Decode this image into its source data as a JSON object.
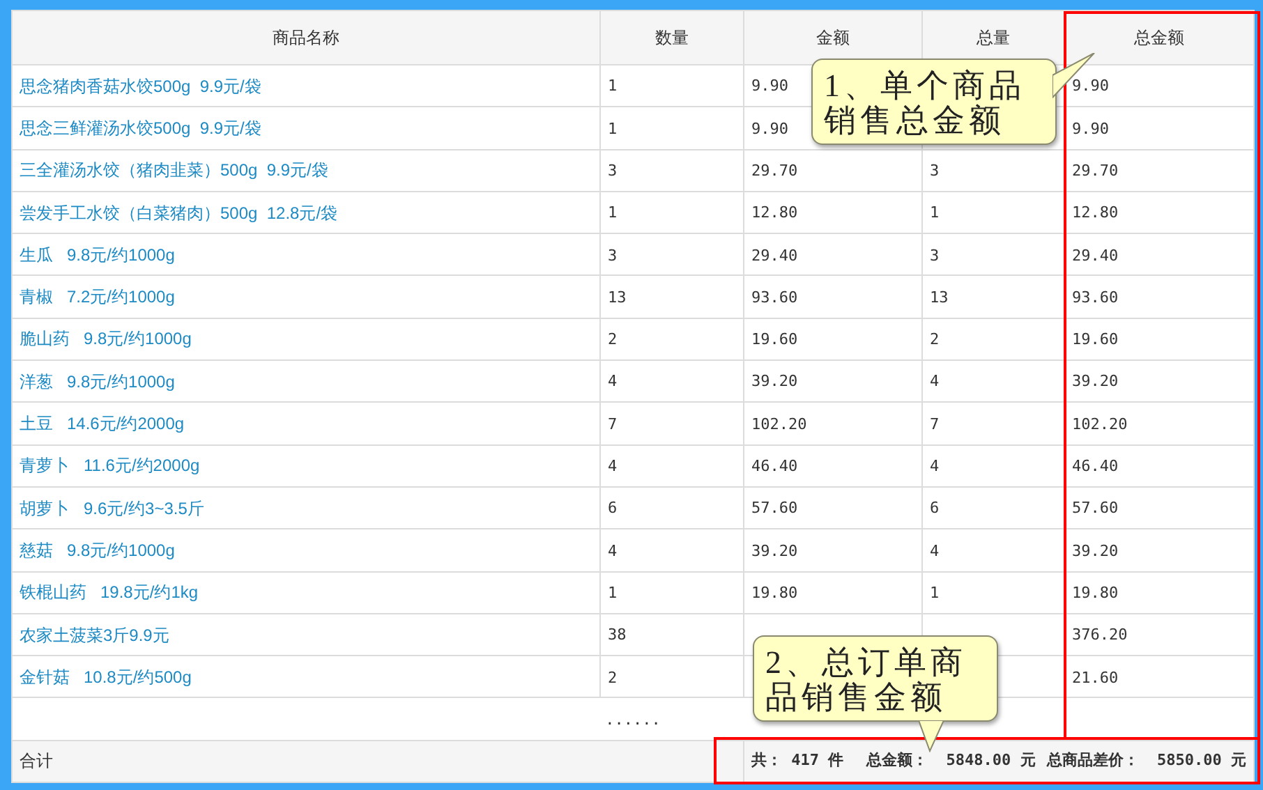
{
  "table": {
    "columns": [
      "商品名称",
      "数量",
      "金额",
      "总量",
      "总金额"
    ],
    "rows": [
      {
        "name": "思念猪肉香菇水饺500g  9.9元/袋",
        "qty": "1",
        "amount": "9.90",
        "total_qty": null,
        "total_amount": "9.90"
      },
      {
        "name": "思念三鲜灌汤水饺500g  9.9元/袋",
        "qty": "1",
        "amount": "9.90",
        "total_qty": null,
        "total_amount": "9.90"
      },
      {
        "name": "三全灌汤水饺（猪肉韭菜）500g  9.9元/袋",
        "qty": "3",
        "amount": "29.70",
        "total_qty": "3",
        "total_amount": "29.70"
      },
      {
        "name": "尝发手工水饺（白菜猪肉）500g  12.8元/袋",
        "qty": "1",
        "amount": "12.80",
        "total_qty": "1",
        "total_amount": "12.80"
      },
      {
        "name": "生瓜   9.8元/约1000g",
        "qty": "3",
        "amount": "29.40",
        "total_qty": "3",
        "total_amount": "29.40"
      },
      {
        "name": "青椒   7.2元/约1000g",
        "qty": "13",
        "amount": "93.60",
        "total_qty": "13",
        "total_amount": "93.60"
      },
      {
        "name": "脆山药   9.8元/约1000g",
        "qty": "2",
        "amount": "19.60",
        "total_qty": "2",
        "total_amount": "19.60"
      },
      {
        "name": "洋葱   9.8元/约1000g",
        "qty": "4",
        "amount": "39.20",
        "total_qty": "4",
        "total_amount": "39.20"
      },
      {
        "name": "土豆   14.6元/约2000g",
        "qty": "7",
        "amount": "102.20",
        "total_qty": "7",
        "total_amount": "102.20"
      },
      {
        "name": "青萝卜   11.6元/约2000g",
        "qty": "4",
        "amount": "46.40",
        "total_qty": "4",
        "total_amount": "46.40"
      },
      {
        "name": "胡萝卜   9.6元/约3~3.5斤",
        "qty": "6",
        "amount": "57.60",
        "total_qty": "6",
        "total_amount": "57.60"
      },
      {
        "name": "慈菇   9.8元/约1000g",
        "qty": "4",
        "amount": "39.20",
        "total_qty": "4",
        "total_amount": "39.20"
      },
      {
        "name": "铁棍山药   19.8元/约1kg",
        "qty": "1",
        "amount": "19.80",
        "total_qty": "1",
        "total_amount": "19.80"
      },
      {
        "name": "农家土菠菜3斤9.9元",
        "qty": "38",
        "amount": null,
        "total_qty": null,
        "total_amount": "376.20"
      },
      {
        "name": "金针菇   10.8元/约500g",
        "qty": "2",
        "amount": null,
        "total_qty": null,
        "total_amount": "21.60"
      }
    ],
    "ellipsis": "......",
    "footer": {
      "label": "合计",
      "count": "共： 417 件",
      "total": "总金额：  5848.00 元",
      "difference": "总商品差价：  5850.00 元"
    }
  },
  "callouts": [
    {
      "text": "1、单个商品销售总金额"
    },
    {
      "text": "2、总订单商品销售金额"
    }
  ]
}
